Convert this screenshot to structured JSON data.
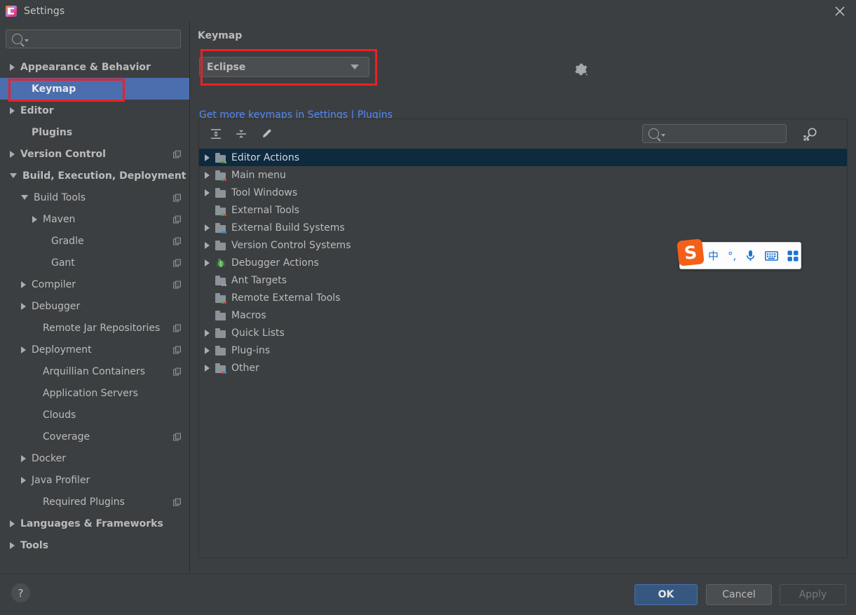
{
  "window": {
    "title": "Settings",
    "app_icon": "intellij-idea-icon",
    "close_icon": "close-icon"
  },
  "sidebar": {
    "search": {
      "placeholder": "",
      "value": "",
      "icon": "search-icon"
    },
    "items": [
      {
        "label": "Appearance & Behavior",
        "indent": 0,
        "arrow": "right",
        "bold": true,
        "copy": false,
        "selected": false
      },
      {
        "label": "Keymap",
        "indent": 1,
        "arrow": "none",
        "bold": true,
        "copy": false,
        "selected": true
      },
      {
        "label": "Editor",
        "indent": 0,
        "arrow": "right",
        "bold": true,
        "copy": false,
        "selected": false
      },
      {
        "label": "Plugins",
        "indent": 1,
        "arrow": "none",
        "bold": true,
        "copy": false,
        "selected": false
      },
      {
        "label": "Version Control",
        "indent": 0,
        "arrow": "right",
        "bold": true,
        "copy": true,
        "selected": false
      },
      {
        "label": "Build, Execution, Deployment",
        "indent": 0,
        "arrow": "down",
        "bold": true,
        "copy": false,
        "selected": false
      },
      {
        "label": "Build Tools",
        "indent": 1,
        "arrow": "down",
        "bold": false,
        "copy": true,
        "selected": false
      },
      {
        "label": "Maven",
        "indent": 2,
        "arrow": "right",
        "bold": false,
        "copy": true,
        "selected": false
      },
      {
        "label": "Gradle",
        "indent": 3,
        "arrow": "none",
        "bold": false,
        "copy": true,
        "selected": false
      },
      {
        "label": "Gant",
        "indent": 3,
        "arrow": "none",
        "bold": false,
        "copy": true,
        "selected": false
      },
      {
        "label": "Compiler",
        "indent": 1,
        "arrow": "right",
        "bold": false,
        "copy": true,
        "selected": false
      },
      {
        "label": "Debugger",
        "indent": 1,
        "arrow": "right",
        "bold": false,
        "copy": false,
        "selected": false
      },
      {
        "label": "Remote Jar Repositories",
        "indent": 2,
        "arrow": "none",
        "bold": false,
        "copy": true,
        "selected": false
      },
      {
        "label": "Deployment",
        "indent": 1,
        "arrow": "right",
        "bold": false,
        "copy": true,
        "selected": false
      },
      {
        "label": "Arquillian Containers",
        "indent": 2,
        "arrow": "none",
        "bold": false,
        "copy": true,
        "selected": false
      },
      {
        "label": "Application Servers",
        "indent": 2,
        "arrow": "none",
        "bold": false,
        "copy": false,
        "selected": false
      },
      {
        "label": "Clouds",
        "indent": 2,
        "arrow": "none",
        "bold": false,
        "copy": false,
        "selected": false
      },
      {
        "label": "Coverage",
        "indent": 2,
        "arrow": "none",
        "bold": false,
        "copy": true,
        "selected": false
      },
      {
        "label": "Docker",
        "indent": 1,
        "arrow": "right",
        "bold": false,
        "copy": false,
        "selected": false
      },
      {
        "label": "Java Profiler",
        "indent": 1,
        "arrow": "right",
        "bold": false,
        "copy": false,
        "selected": false
      },
      {
        "label": "Required Plugins",
        "indent": 2,
        "arrow": "none",
        "bold": false,
        "copy": true,
        "selected": false
      },
      {
        "label": "Languages & Frameworks",
        "indent": 0,
        "arrow": "right",
        "bold": true,
        "copy": false,
        "selected": false
      },
      {
        "label": "Tools",
        "indent": 0,
        "arrow": "right",
        "bold": true,
        "copy": false,
        "selected": false
      }
    ]
  },
  "main": {
    "page_title": "Keymap",
    "keymap_select": {
      "value": "Eclipse",
      "icon": "chevron-down-icon"
    },
    "gear_icon": "gear-icon",
    "link": "Get more keymaps in Settings | Plugins",
    "toolbar": {
      "expand_all": "expand-all-icon",
      "collapse_all": "collapse-all-icon",
      "edit": "edit-pencil-icon",
      "find_shortcut": "find-by-shortcut-icon"
    },
    "find": {
      "placeholder": "",
      "value": "",
      "icon": "search-icon"
    },
    "actions_tree": [
      {
        "label": "Editor Actions",
        "arrow": true,
        "icon": "folder-editor-icon",
        "selected": true
      },
      {
        "label": "Main menu",
        "arrow": true,
        "icon": "folder-menu-icon",
        "selected": false
      },
      {
        "label": "Tool Windows",
        "arrow": true,
        "icon": "folder-icon",
        "selected": false
      },
      {
        "label": "External Tools",
        "arrow": false,
        "icon": "folder-tools-icon",
        "selected": false
      },
      {
        "label": "External Build Systems",
        "arrow": true,
        "icon": "folder-gear-icon",
        "selected": false
      },
      {
        "label": "Version Control Systems",
        "arrow": true,
        "icon": "folder-icon",
        "selected": false
      },
      {
        "label": "Debugger Actions",
        "arrow": true,
        "icon": "bug-icon",
        "selected": false
      },
      {
        "label": "Ant Targets",
        "arrow": false,
        "icon": "folder-ant-icon",
        "selected": false
      },
      {
        "label": "Remote External Tools",
        "arrow": false,
        "icon": "folder-tools-icon",
        "selected": false
      },
      {
        "label": "Macros",
        "arrow": false,
        "icon": "folder-icon",
        "selected": false
      },
      {
        "label": "Quick Lists",
        "arrow": true,
        "icon": "folder-icon",
        "selected": false
      },
      {
        "label": "Plug-ins",
        "arrow": true,
        "icon": "folder-icon",
        "selected": false
      },
      {
        "label": "Other",
        "arrow": true,
        "icon": "folder-other-icon",
        "selected": false
      }
    ]
  },
  "ime_toolbar": {
    "logo": "S",
    "items": [
      {
        "label": "中",
        "name": "chinese-mode-icon"
      },
      {
        "label": "°,",
        "name": "punctuation-mode-icon"
      },
      {
        "label": "",
        "name": "microphone-icon"
      },
      {
        "label": "",
        "name": "keyboard-icon"
      },
      {
        "label": "",
        "name": "app-grid-icon"
      }
    ]
  },
  "footer": {
    "help": "?",
    "ok": "OK",
    "cancel": "Cancel",
    "apply": "Apply"
  },
  "colors": {
    "background": "#3c3f41",
    "sidebar_selected": "#4b6eaf",
    "tree_selected": "#0d2a3f",
    "annotation_red": "#ed2024",
    "link_blue": "#548af7",
    "ok_button": "#365880",
    "ime_orange": "#f4601a",
    "ime_blue": "#1f73d0"
  }
}
